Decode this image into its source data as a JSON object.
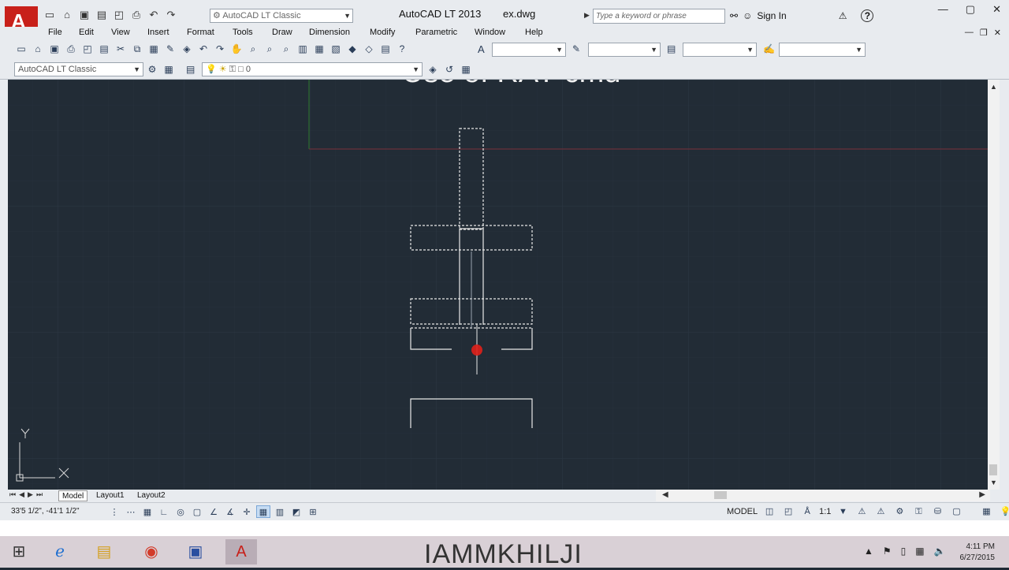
{
  "titlebar": {
    "app_title": "AutoCAD LT 2013",
    "doc_name": "ex.dwg",
    "workspace": "AutoCAD LT Classic",
    "search_placeholder": "Type a keyword or phrase",
    "sign_in": "Sign In",
    "help": "?"
  },
  "menu": [
    "File",
    "Edit",
    "View",
    "Insert",
    "Format",
    "Tools",
    "Draw",
    "Dimension",
    "Modify",
    "Parametric",
    "Window",
    "Help"
  ],
  "toolbar2": {
    "workspace": "AutoCAD LT Classic",
    "layer": "0"
  },
  "canvas": {
    "overlay_text": "Use of RAY cmd",
    "ucs_x": "X",
    "ucs_y": "Y"
  },
  "tabs": [
    "Model",
    "Layout1",
    "Layout2"
  ],
  "status": {
    "coords": "33'5 1/2\", -41'1 1/2\"",
    "space": "MODEL",
    "scale": "1:1"
  },
  "taskbar": {
    "brand": "IAMMKHILJI",
    "time": "4:11 PM",
    "date": "6/27/2015"
  },
  "colors": {
    "canvas_bg": "#222c36",
    "ui_bg": "#e8ebef",
    "cursor": "#e0201a"
  }
}
